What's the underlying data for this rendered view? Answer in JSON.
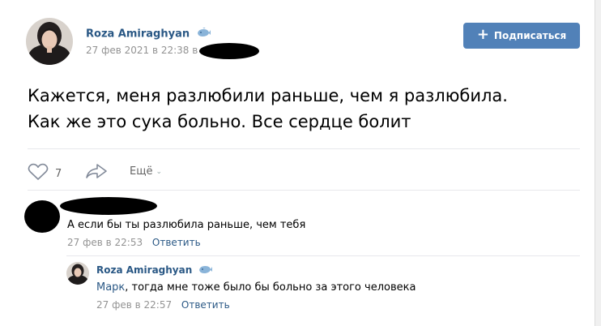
{
  "post": {
    "author": "Roza Amiraghyan",
    "time": "27 фев 2021 в 22:38 в",
    "text_line1": "Кажется, меня разлюбили раньше, чем я разлюбила.",
    "text_line2": "Как же это сука больно. Все сердце болит",
    "subscribe_label": "Подписаться",
    "likes": "7",
    "more_label": "Ещё"
  },
  "comments": [
    {
      "text": "А если бы ты разлюбила раньше, чем тебя",
      "time": "27 фев в 22:53",
      "reply_label": "Ответить"
    },
    {
      "author": "Roza Amiraghyan",
      "mention": "Марк",
      "text": ", тогда мне тоже было бы больно за этого человека",
      "time": "27 фев в 22:57",
      "reply_label": "Ответить"
    }
  ],
  "colors": {
    "link": "#2a5885",
    "button": "#5181b8",
    "meta": "#939393",
    "divider": "#e7e8ec"
  },
  "icons": [
    "whale-icon",
    "plus-icon",
    "heart-icon",
    "share-icon",
    "chevron-down-icon"
  ]
}
